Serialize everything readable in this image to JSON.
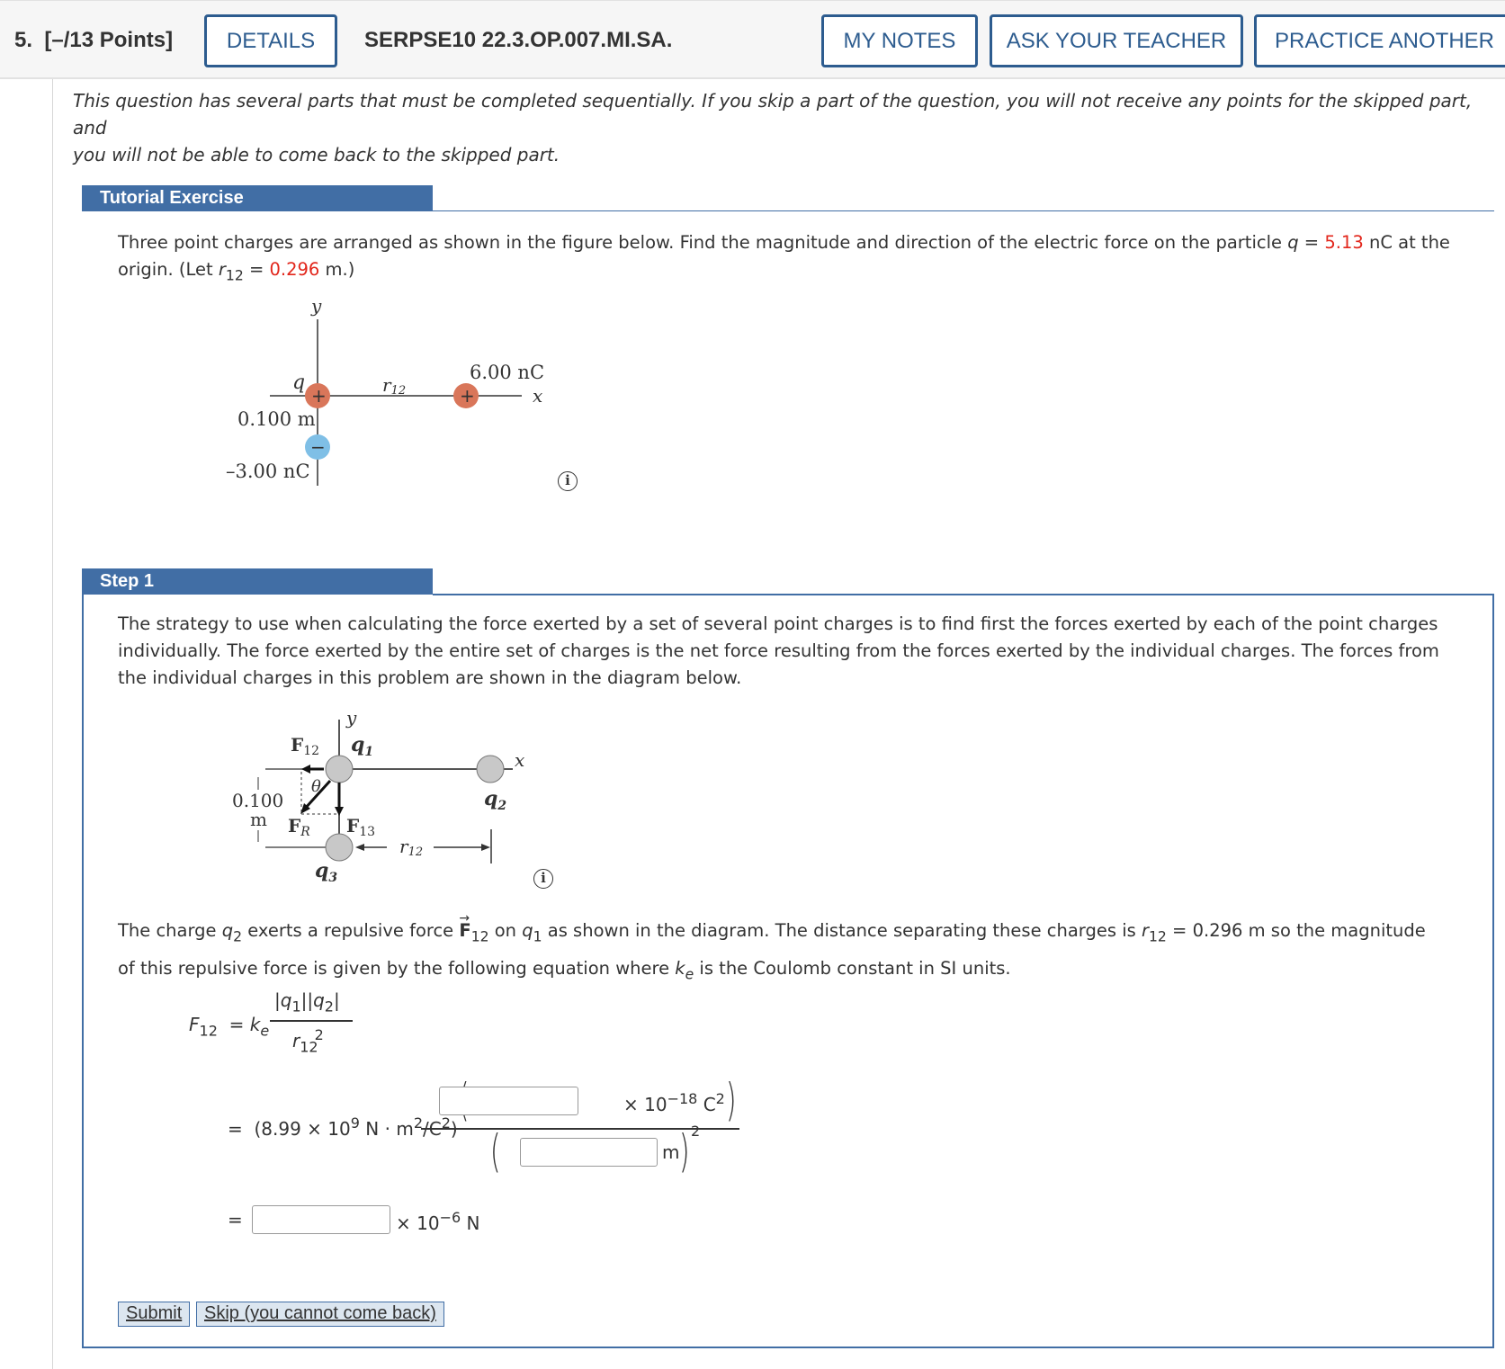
{
  "header": {
    "question_number": "5.",
    "points": "[–/13 Points]",
    "details_label": "DETAILS",
    "problem_code": "SERPSE10 22.3.OP.007.MI.SA.",
    "my_notes_label": "MY NOTES",
    "ask_teacher_label": "ASK YOUR TEACHER",
    "practice_another_label": "PRACTICE ANOTHER"
  },
  "intro": {
    "line1": "This question has several parts that must be completed sequentially. If you skip a part of the question, you will not receive any points for the skipped part, and",
    "line2": "you will not be able to come back to the skipped part."
  },
  "tutorial": {
    "heading": "Tutorial Exercise",
    "text_a": "Three point charges are arranged as shown in the figure below. Find the magnitude and direction of the electric force on the particle ",
    "q_symbol": "q",
    "text_b": " = ",
    "q_value": "5.13",
    "text_c": " nC at the",
    "text_d": "origin. (Let ",
    "r_symbol": "r",
    "r_sub": "12",
    "text_e": " = ",
    "r_value": "0.296",
    "text_f": " m.)",
    "figure": {
      "y_label": "y",
      "x_label": "x",
      "q_label": "q",
      "r12_label": "r",
      "r12_sub": "12",
      "charge2_label": "6.00 nC",
      "distance_label": "0.100 m",
      "charge3_label": "–3.00 nC",
      "plus": "+",
      "minus": "−"
    },
    "info_glyph": "i"
  },
  "step1": {
    "heading": "Step 1",
    "para1": [
      "The strategy to use when calculating the force exerted by a set of several point charges is to find first the forces exerted by each of the point charges",
      "individually. The force exerted by the entire set of charges is the net force resulting from the forces exerted by the individual charges. The forces from",
      "the individual charges in this problem are shown in the diagram below."
    ],
    "figure": {
      "y_label": "y",
      "x_label": "x",
      "F12": "F",
      "F12_sub": "12",
      "q1": "q",
      "q1_sub": "1",
      "q2": "q",
      "q2_sub": "2",
      "q3": "q",
      "q3_sub": "3",
      "theta": "θ",
      "FR": "F",
      "FR_sub": "R",
      "F13": "F",
      "F13_sub": "13",
      "distance_top": "0.100",
      "distance_unit": "m",
      "r12": "r",
      "r12_sub": "12"
    },
    "info_glyph": "i",
    "para2": {
      "t1": "The charge ",
      "q2": "q",
      "q2_sub": "2",
      "t2": " exerts a repulsive force ",
      "F": "F",
      "F_sub": "12",
      "t3": " on ",
      "q1": "q",
      "q1_sub": "1",
      "t4": " as shown in the diagram. The distance separating these charges is ",
      "r": "r",
      "r_sub": "12",
      "t5": " = 0.296 m so the magnitude",
      "t6": "of this repulsive force is given by the following equation where ",
      "k": "k",
      "k_sub": "e",
      "t7": " is the Coulomb constant in SI units."
    },
    "equation": {
      "lhs": "F",
      "lhs_sub": "12",
      "equals": "=",
      "k": "k",
      "k_sub": "e",
      "numerator": "|q",
      "num_sub1": "1",
      "num_mid": "||q",
      "num_sub2": "2",
      "num_end": "|",
      "denom": "r",
      "denom_sub": "12",
      "denom_sup": "2",
      "line2_prefix": "(8.99 × 10",
      "line2_exp": "9",
      "line2_units_a": " N · m",
      "line2_units_sup1": "2",
      "line2_units_b": "/C",
      "line2_units_sup2": "2",
      "line2_units_c": ")",
      "num_factor": "× 10",
      "num_exp": "−18",
      "num_unit": " C",
      "num_unit_sup": "2",
      "denom_unit": "m",
      "denom_exp": "2",
      "result_factor": "× 10",
      "result_exp": "−6",
      "result_unit": " N"
    },
    "inputs": {
      "charge_product": "",
      "distance": "",
      "force": ""
    },
    "submit_label": "Submit",
    "skip_label": "Skip (you cannot come back)"
  }
}
